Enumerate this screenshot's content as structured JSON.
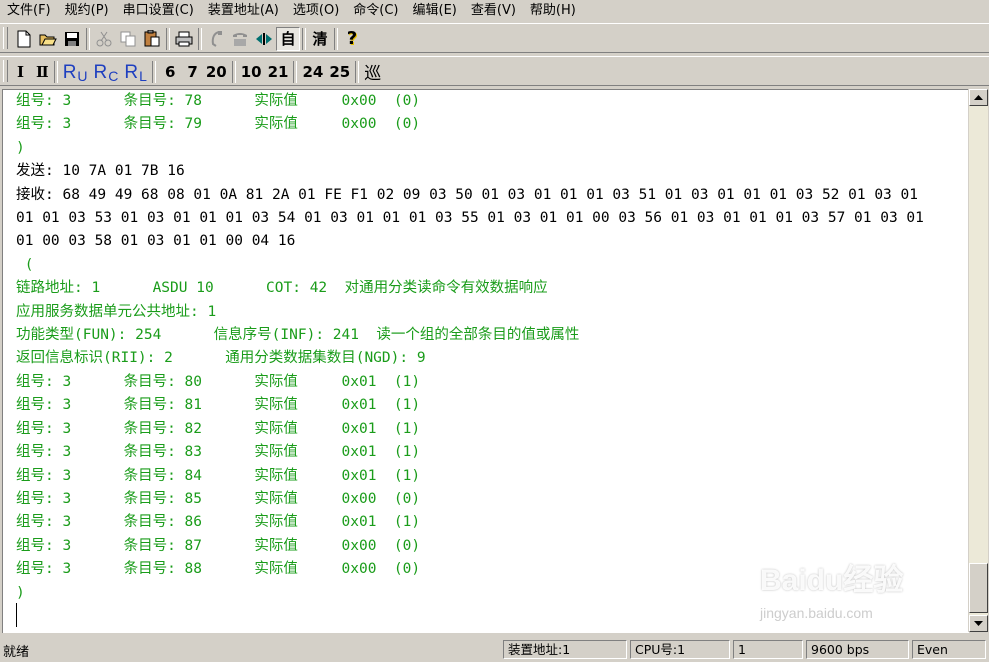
{
  "menu": [
    "文件(F)",
    "规约(P)",
    "串口设置(C)",
    "装置地址(A)",
    "选项(O)",
    "命令(C)",
    "编辑(E)",
    "查看(V)",
    "帮助(H)"
  ],
  "toolbar1": {
    "auto_label": "自",
    "clear_label": "清",
    "help_label": "?"
  },
  "toolbar2": {
    "roman1": "Ⅰ",
    "roman2": "Ⅱ",
    "ru": {
      "big": "R",
      "sub": "U"
    },
    "rc": {
      "big": "R",
      "sub": "C"
    },
    "rl": {
      "big": "R",
      "sub": "L"
    },
    "num6": "6",
    "num7": "7",
    "num20": "20",
    "num10": "10",
    "num21": "21",
    "num24": "24",
    "num25": "25",
    "patrol": "巡"
  },
  "log": [
    {
      "text": "组号: 3      条目号: 78      实际值     0x00  (0)",
      "color": "green"
    },
    {
      "text": "组号: 3      条目号: 79      实际值     0x00  (0)",
      "color": "green"
    },
    {
      "text": ")",
      "color": "green"
    },
    {
      "text": "发送: 10 7A 01 7B 16",
      "color": "black"
    },
    {
      "text": "接收: 68 49 49 68 08 01 0A 81 2A 01 FE F1 02 09 03 50 01 03 01 01 01 03 51 01 03 01 01 01 03 52 01 03 01",
      "color": "black"
    },
    {
      "text": "01 01 03 53 01 03 01 01 01 03 54 01 03 01 01 01 03 55 01 03 01 01 00 03 56 01 03 01 01 01 03 57 01 03 01",
      "color": "black"
    },
    {
      "text": "01 00 03 58 01 03 01 01 00 04 16",
      "color": "black"
    },
    {
      "text": " (",
      "color": "green"
    },
    {
      "text": "链路地址: 1      ASDU 10      COT: 42  对通用分类读命令有效数据响应",
      "color": "green"
    },
    {
      "text": "应用服务数据单元公共地址: 1",
      "color": "green"
    },
    {
      "text": "功能类型(FUN): 254      信息序号(INF): 241  读一个组的全部条目的值或属性",
      "color": "green"
    },
    {
      "text": "返回信息标识(RII): 2      通用分类数据集数目(NGD): 9",
      "color": "green"
    },
    {
      "text": "组号: 3      条目号: 80      实际值     0x01  (1)",
      "color": "green"
    },
    {
      "text": "组号: 3      条目号: 81      实际值     0x01  (1)",
      "color": "green"
    },
    {
      "text": "组号: 3      条目号: 82      实际值     0x01  (1)",
      "color": "green"
    },
    {
      "text": "组号: 3      条目号: 83      实际值     0x01  (1)",
      "color": "green"
    },
    {
      "text": "组号: 3      条目号: 84      实际值     0x01  (1)",
      "color": "green"
    },
    {
      "text": "组号: 3      条目号: 85      实际值     0x00  (0)",
      "color": "green"
    },
    {
      "text": "组号: 3      条目号: 86      实际值     0x01  (1)",
      "color": "green"
    },
    {
      "text": "组号: 3      条目号: 87      实际值     0x00  (0)",
      "color": "green"
    },
    {
      "text": "组号: 3      条目号: 88      实际值     0x00  (0)",
      "color": "green"
    },
    {
      "text": ")",
      "color": "green"
    }
  ],
  "status": {
    "ready": "就绪",
    "device_address": "装置地址:1",
    "cpu": "CPU号:1",
    "num": "1",
    "baud": "9600 bps",
    "parity": "Even"
  },
  "watermark": {
    "main": "Baidu经验",
    "sub": "jingyan.baidu.com"
  },
  "colors": {
    "green": "#1a9c1a",
    "background": "#d4d0c8",
    "text": "#000000",
    "toolbar_r": "#1e3fc0"
  }
}
